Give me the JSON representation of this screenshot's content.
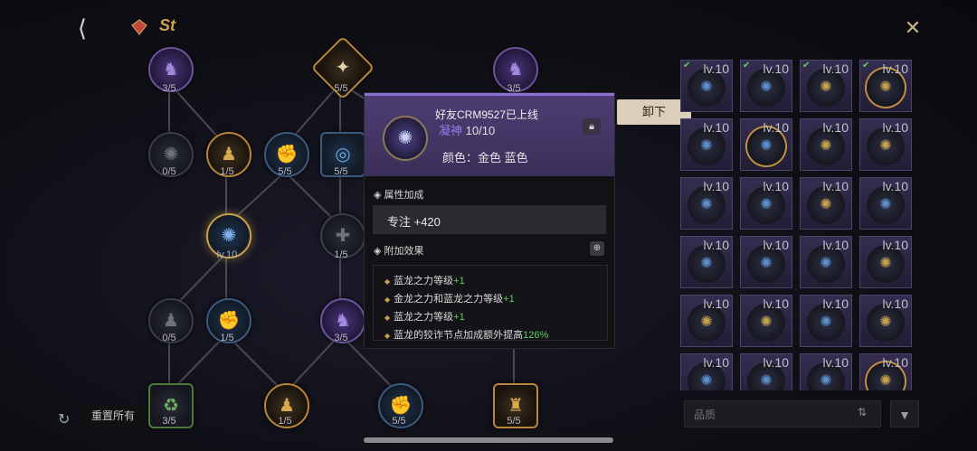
{
  "topbar": {
    "back_icon": "back-arrow-icon",
    "gem_icon": "gem-icon",
    "logo_text": "St",
    "close_icon": "close-icon"
  },
  "tree": {
    "nodes": [
      {
        "id": "n1",
        "label": "3/5",
        "style": "purple"
      },
      {
        "id": "n2",
        "label": "5/5",
        "style": "gold diamond"
      },
      {
        "id": "n3",
        "label": "3/5",
        "style": "purple"
      },
      {
        "id": "n4",
        "label": "0/5",
        "style": ""
      },
      {
        "id": "n5",
        "label": "1/5",
        "style": "gold"
      },
      {
        "id": "n6",
        "label": "5/5",
        "style": "blue"
      },
      {
        "id": "n7",
        "label": "5/5",
        "style": "blue square"
      },
      {
        "id": "n8",
        "label": "lv.10",
        "style": "blue active"
      },
      {
        "id": "n9",
        "label": "1/5",
        "style": ""
      },
      {
        "id": "n10",
        "label": "0/5",
        "style": ""
      },
      {
        "id": "n11",
        "label": "1/5",
        "style": "blue"
      },
      {
        "id": "n12",
        "label": "3/5",
        "style": "purple"
      },
      {
        "id": "n13",
        "label": "3/5",
        "style": "square"
      },
      {
        "id": "n14",
        "label": "1/5",
        "style": "gold"
      },
      {
        "id": "n15",
        "label": "5/5",
        "style": "blue"
      },
      {
        "id": "n16",
        "label": "5/5",
        "style": "gold square"
      }
    ]
  },
  "popup": {
    "title": "好友CRM9527已上线",
    "sub_tag": "凝神",
    "sub_value": "10/10",
    "color_label": "颜色：金色 蓝色",
    "lock_icon": "lock-icon",
    "attr_header": "属性加成",
    "attr_value": "专注 +420",
    "effect_header": "附加效果",
    "zoom_icon": "zoom-icon",
    "effects": [
      {
        "text": "蓝龙之力等级",
        "bonus": "+1"
      },
      {
        "text": "金龙之力和蓝龙之力等级",
        "bonus": "+1"
      },
      {
        "text": "蓝龙之力等级",
        "bonus": "+1"
      },
      {
        "text": "蓝龙的狡诈节点加成额外提高",
        "bonus": "126%"
      }
    ]
  },
  "unequip_label": "卸下",
  "grid": {
    "level_label": "lv.10",
    "cells": [
      {
        "check": true,
        "tone": "blue"
      },
      {
        "check": true,
        "tone": "blue"
      },
      {
        "check": true,
        "tone": "gold"
      },
      {
        "check": true,
        "tone": "gold",
        "ring": true
      },
      {
        "check": false,
        "tone": "blue"
      },
      {
        "check": false,
        "tone": "blue",
        "ring": true
      },
      {
        "check": false,
        "tone": "gold"
      },
      {
        "check": false,
        "tone": "gold"
      },
      {
        "check": false,
        "tone": "blue"
      },
      {
        "check": false,
        "tone": "blue"
      },
      {
        "check": false,
        "tone": "gold"
      },
      {
        "check": false,
        "tone": "blue"
      },
      {
        "check": false,
        "tone": "blue"
      },
      {
        "check": false,
        "tone": "blue"
      },
      {
        "check": false,
        "tone": "blue"
      },
      {
        "check": false,
        "tone": "gold"
      },
      {
        "check": false,
        "tone": "gold"
      },
      {
        "check": false,
        "tone": "gold"
      },
      {
        "check": false,
        "tone": "blue"
      },
      {
        "check": false,
        "tone": "gold"
      },
      {
        "check": false,
        "tone": "blue"
      },
      {
        "check": false,
        "tone": "blue"
      },
      {
        "check": false,
        "tone": "blue"
      },
      {
        "check": false,
        "tone": "gold",
        "ring": true
      }
    ]
  },
  "search": {
    "placeholder": "品质"
  },
  "reset_label": "重置所有",
  "colors": {
    "gold": "#c9a24f",
    "blue": "#5a8fd0",
    "green": "#5fcf5f",
    "purple": "#8f80e6"
  }
}
